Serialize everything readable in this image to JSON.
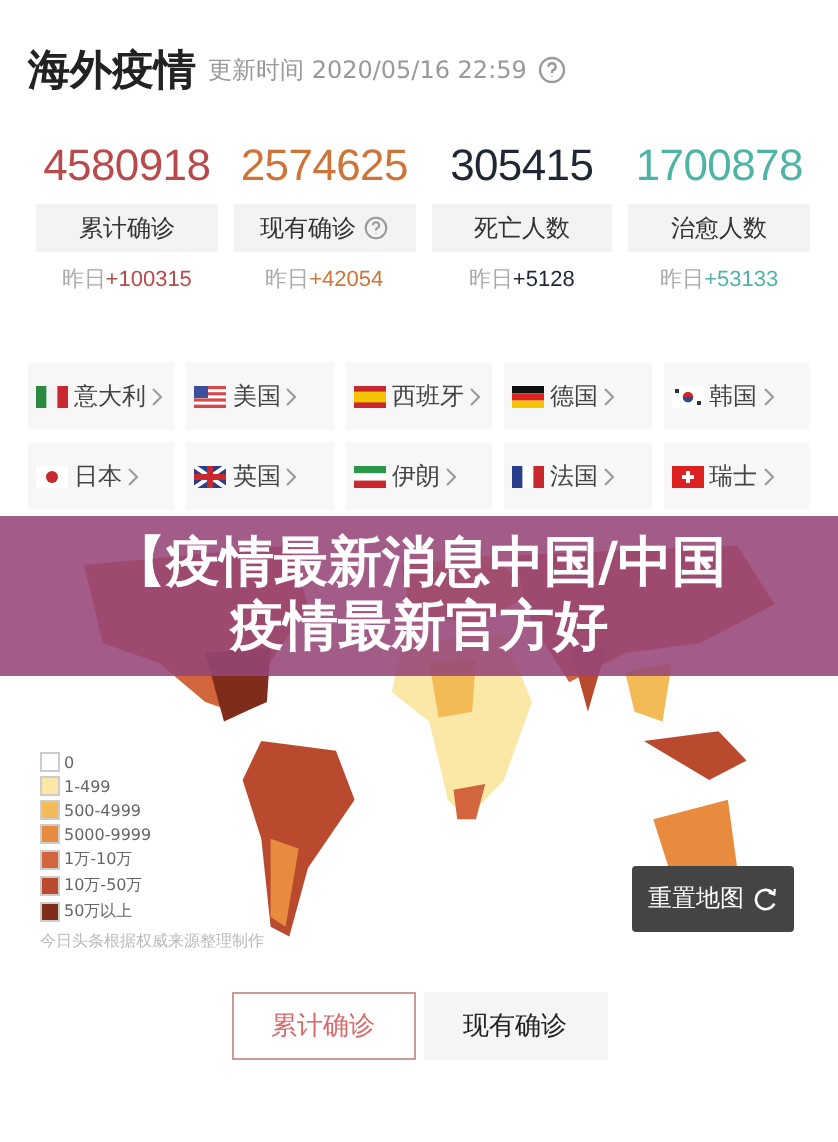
{
  "header": {
    "title": "海外疫情",
    "update_time": "更新时间 2020/05/16 22:59"
  },
  "stats": [
    {
      "value": "4580918",
      "label": "累计确诊",
      "help": false,
      "yesterday_label": "昨日",
      "yesterday_value": "+100315",
      "color": "#b94a4c"
    },
    {
      "value": "2574625",
      "label": "现有确诊",
      "help": true,
      "yesterday_label": "昨日",
      "yesterday_value": "+42054",
      "color": "#cf7437"
    },
    {
      "value": "305415",
      "label": "死亡人数",
      "help": false,
      "yesterday_label": "昨日",
      "yesterday_value": "+5128",
      "color": "#1e2733"
    },
    {
      "value": "1700878",
      "label": "治愈人数",
      "help": false,
      "yesterday_label": "昨日",
      "yesterday_value": "+53133",
      "color": "#4db4a6"
    }
  ],
  "countries": [
    {
      "name": "意大利",
      "kind": "italy"
    },
    {
      "name": "美国",
      "kind": "usa"
    },
    {
      "name": "西班牙",
      "kind": "spain"
    },
    {
      "name": "德国",
      "kind": "germany"
    },
    {
      "name": "韩国",
      "kind": "korea"
    },
    {
      "name": "日本",
      "kind": "japan"
    },
    {
      "name": "英国",
      "kind": "uk"
    },
    {
      "name": "伊朗",
      "kind": "iran"
    },
    {
      "name": "法国",
      "kind": "france"
    },
    {
      "name": "瑞士",
      "kind": "swiss"
    }
  ],
  "banner": {
    "title": "【疫情最新消息中国/中国疫情最新官方好"
  },
  "map": {
    "kind": "picture",
    "legend": [
      {
        "label": "0",
        "color": "#ffffff"
      },
      {
        "label": "1-499",
        "color": "#fbe7a6"
      },
      {
        "label": "500-4999",
        "color": "#f2bb55"
      },
      {
        "label": "5000-9999",
        "color": "#e98b3e"
      },
      {
        "label": "1万-10万",
        "color": "#d2653c"
      },
      {
        "label": "10万-50万",
        "color": "#b94a2e"
      },
      {
        "label": "50万以上",
        "color": "#7d2d1a"
      }
    ],
    "source": "今日头条根据权威来源整理制作",
    "reset_button": "重置地图"
  },
  "view_tabs": [
    {
      "label": "累计确诊",
      "selected": true
    },
    {
      "label": "现有确诊",
      "selected": false
    }
  ]
}
